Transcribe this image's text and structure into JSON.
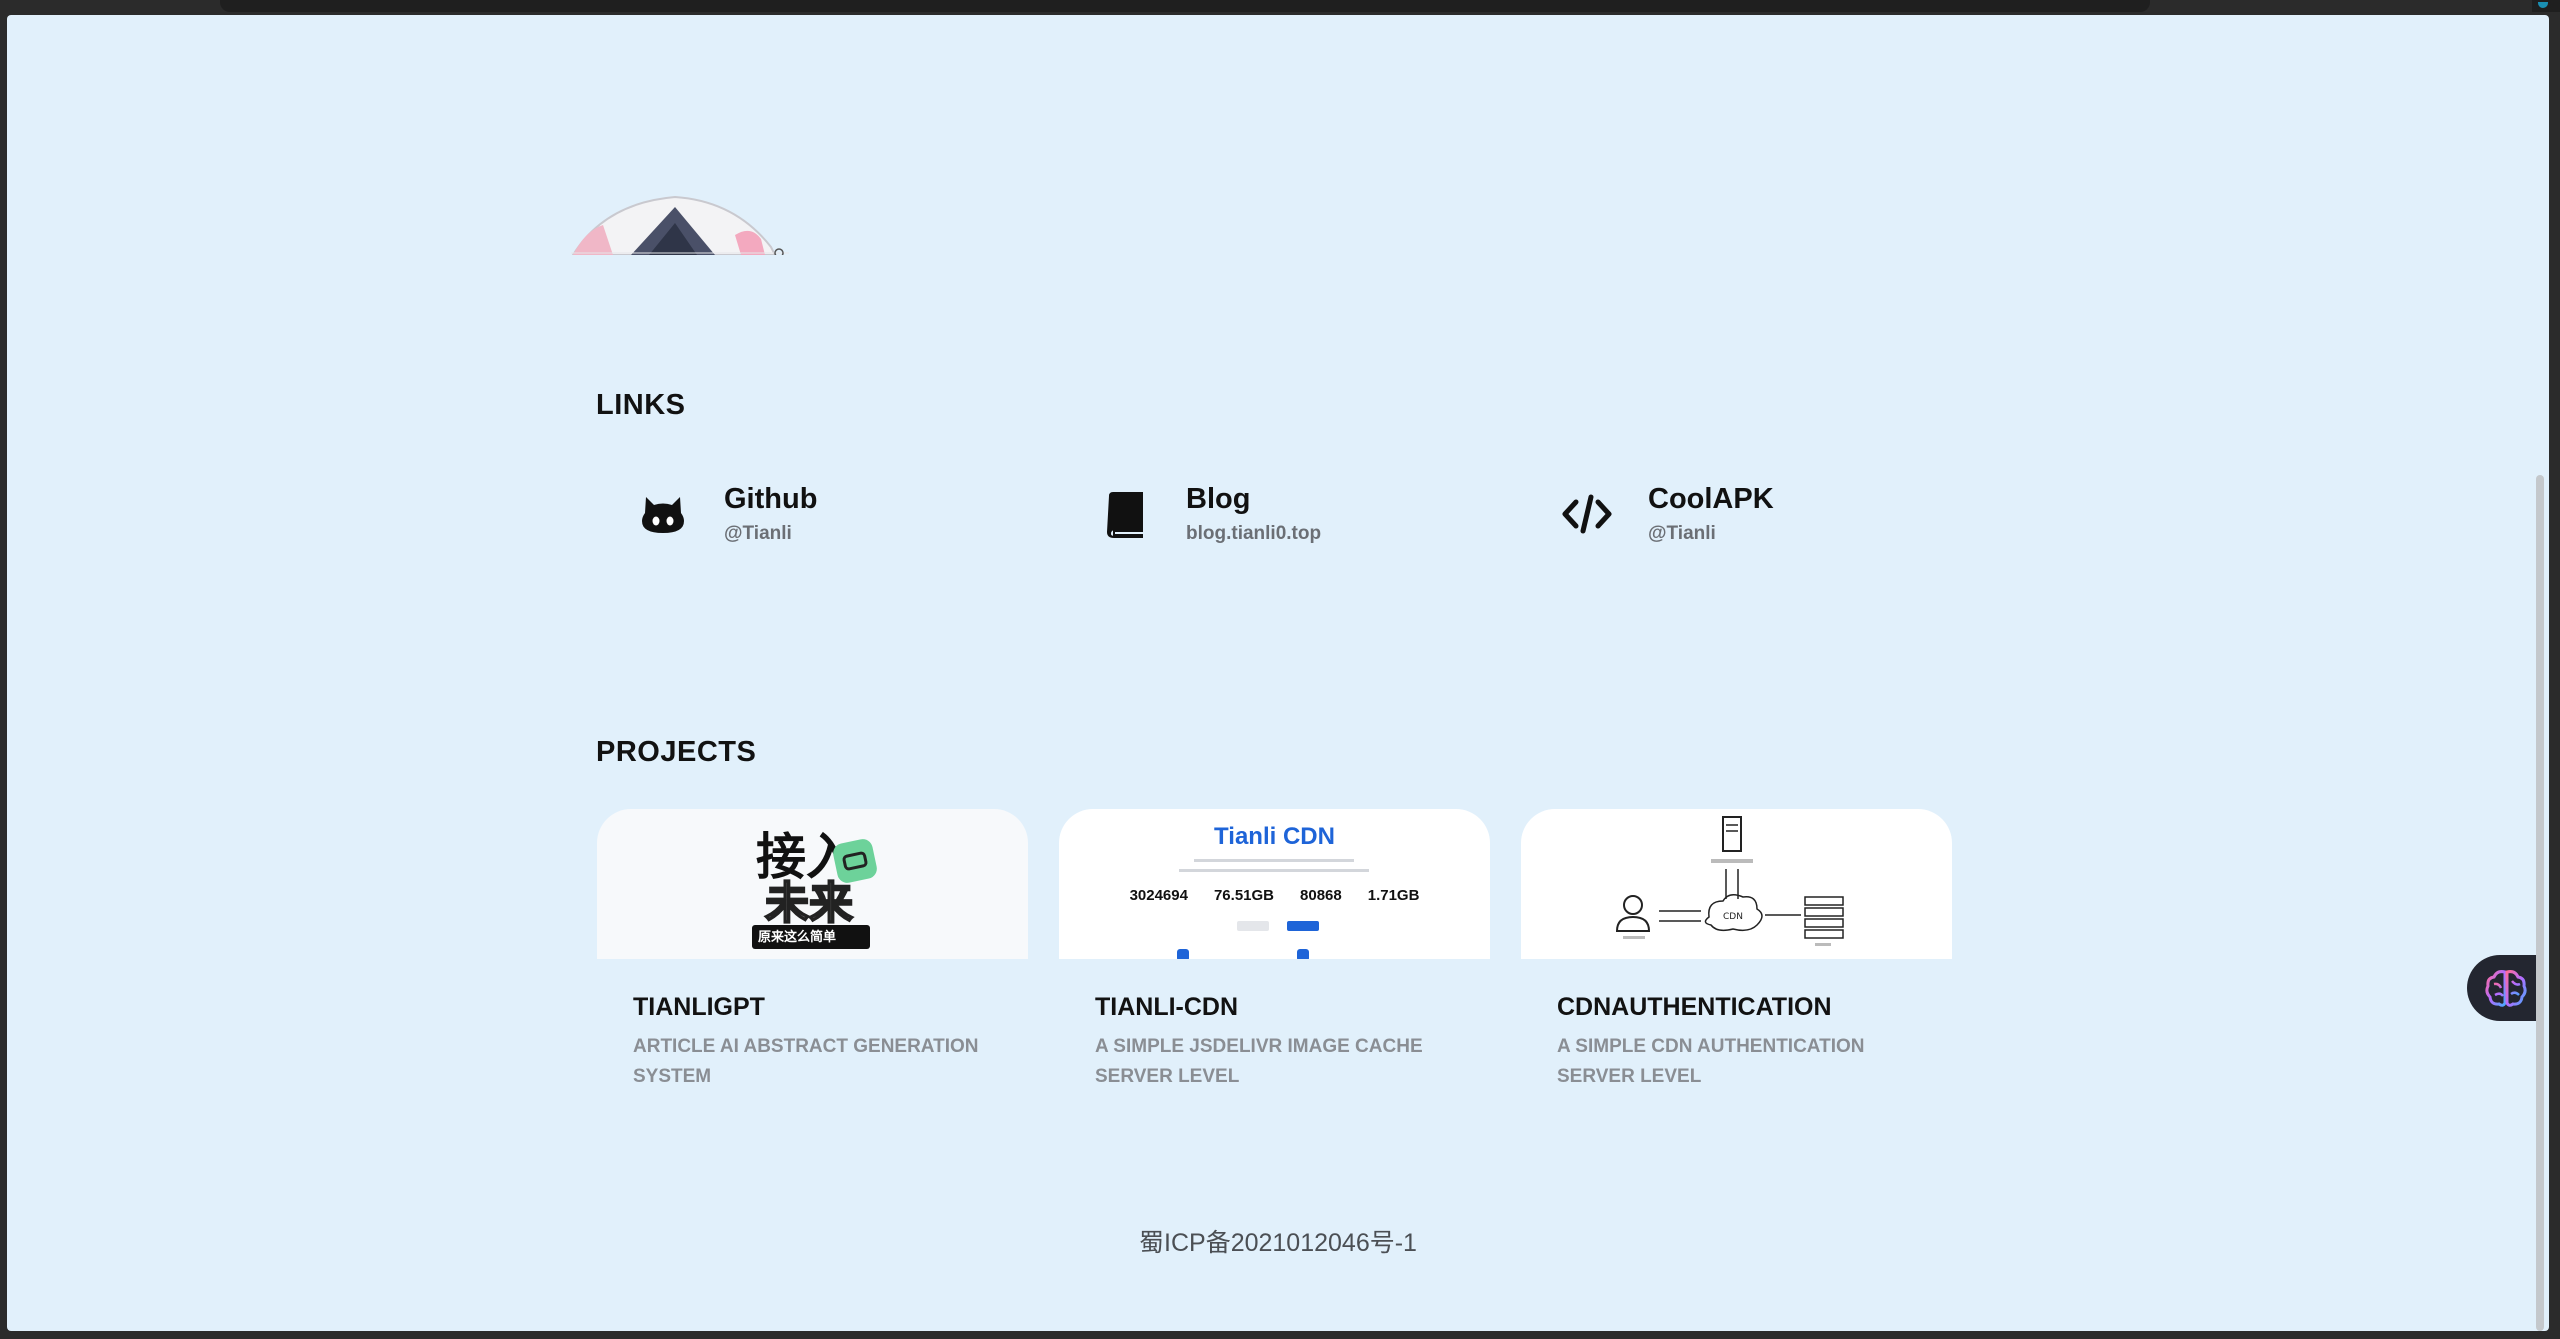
{
  "sections": {
    "links_title": "LINKS",
    "projects_title": "PROJECTS"
  },
  "links": [
    {
      "name": "Github",
      "sub": "@Tianli",
      "icon": "github-icon"
    },
    {
      "name": "Blog",
      "sub": "blog.tianli0.top",
      "icon": "book-icon"
    },
    {
      "name": "CoolAPK",
      "sub": "@Tianli",
      "icon": "code-icon"
    }
  ],
  "projects": [
    {
      "title": "TIANLIGPT",
      "desc": "ARTICLE AI ABSTRACT GENERATION SYSTEM",
      "thumb": {
        "line1": "接入",
        "line2": "未来",
        "caption": "原来这么简单"
      }
    },
    {
      "title": "TIANLI-CDN",
      "desc": "A SIMPLE JSDELIVR IMAGE CACHE SERVER LEVEL",
      "thumb": {
        "heading": "Tianli CDN",
        "stats": [
          "3024694",
          "76.51GB",
          "80868",
          "1.71GB"
        ]
      }
    },
    {
      "title": "CDNAUTHENTICATION",
      "desc": "A SIMPLE CDN AUTHENTICATION SERVER LEVEL",
      "thumb": {
        "node": "CDN"
      }
    }
  ],
  "footer": {
    "icp": "蜀ICP备2021012046号-1"
  },
  "colors": {
    "page_bg": "#e1f0fb",
    "accent_blue": "#1e64d8",
    "float_bg": "#232630"
  }
}
